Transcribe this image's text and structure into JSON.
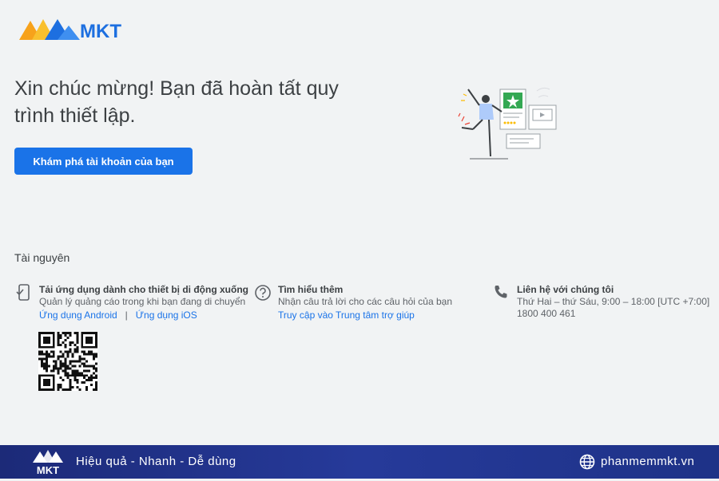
{
  "brand": {
    "logo_text": "MKT"
  },
  "hero": {
    "headline": "Xin chúc mừng! Bạn đã hoàn tất quy trình thiết lập.",
    "cta_label": "Khám phá tài khoản của bạn"
  },
  "resources": {
    "title": "Tài nguyên",
    "mobile": {
      "icon": "phone-download-icon",
      "title": "Tải ứng dụng dành cho thiết bị di động xuống",
      "desc": "Quản lý quảng cáo trong khi bạn đang di chuyển",
      "link_android": "Ứng dụng Android",
      "separator": "|",
      "link_ios": "Ứng dụng iOS"
    },
    "learn": {
      "icon": "help-circle-icon",
      "title": "Tìm hiểu thêm",
      "desc": "Nhận câu trả lời cho các câu hỏi của bạn",
      "link": "Truy cập vào Trung tâm trợ giúp"
    },
    "contact": {
      "icon": "phone-icon",
      "title": "Liên hệ với chúng tôi",
      "hours": "Thứ Hai – thứ Sáu, 9:00 – 18:00 [UTC +7:00]",
      "phone": "1800 400 461"
    }
  },
  "footer": {
    "logo_text": "MKT",
    "slogan": "Hiệu quả - Nhanh - Dễ dùng",
    "website": "phanmemmkt.vn"
  },
  "colors": {
    "accent": "#1a73e8",
    "background": "#f1f3f4",
    "footer": "#22338c"
  }
}
